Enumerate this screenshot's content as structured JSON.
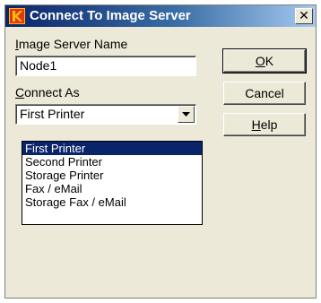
{
  "window": {
    "title": "Connect To Image Server",
    "close_label": "✕"
  },
  "form": {
    "server_name_label_first": "I",
    "server_name_label_rest": "mage Server Name",
    "server_name_value": "Node1",
    "connect_as_label_first": "C",
    "connect_as_label_rest": "onnect As",
    "connect_as_value": "First Printer",
    "connect_as_options": [
      "First Printer",
      "Second Printer",
      "Storage Printer",
      "Fax / eMail",
      "Storage Fax / eMail"
    ]
  },
  "buttons": {
    "ok_first": "O",
    "ok_rest": "K",
    "cancel": "Cancel",
    "help_first": "H",
    "help_rest": "elp"
  },
  "colors": {
    "titlebar_start": "#0a246a",
    "titlebar_end": "#a6caf0",
    "dialog_bg": "#ece9d8",
    "selection": "#0a246a",
    "icon_red": "#e8321e",
    "icon_yellow": "#f5c400"
  },
  "icons": {
    "app": "kodak-k-logo-icon",
    "close": "close-icon",
    "dropdown": "chevron-down-icon"
  }
}
